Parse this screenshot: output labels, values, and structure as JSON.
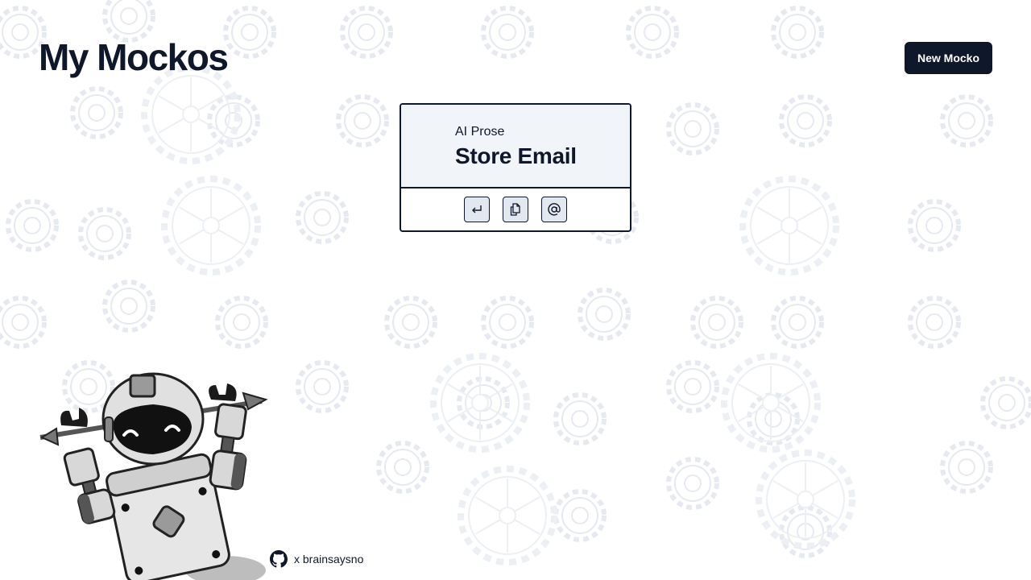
{
  "header": {
    "title": "My Mockos",
    "new_button_label": "New Mocko"
  },
  "cards": [
    {
      "category": "AI Prose",
      "name": "Store Email",
      "actions": [
        {
          "icon": "enter-icon"
        },
        {
          "icon": "copy-icon"
        },
        {
          "icon": "at-sign-icon"
        }
      ]
    }
  ],
  "footer": {
    "icon": "github-icon",
    "text": "x brainsaysno"
  },
  "colors": {
    "primary": "#0f172a",
    "card_top": "#f1f5f9",
    "icon_button_bg": "#e2e8f0",
    "background_pattern": "#e8ecf1"
  }
}
